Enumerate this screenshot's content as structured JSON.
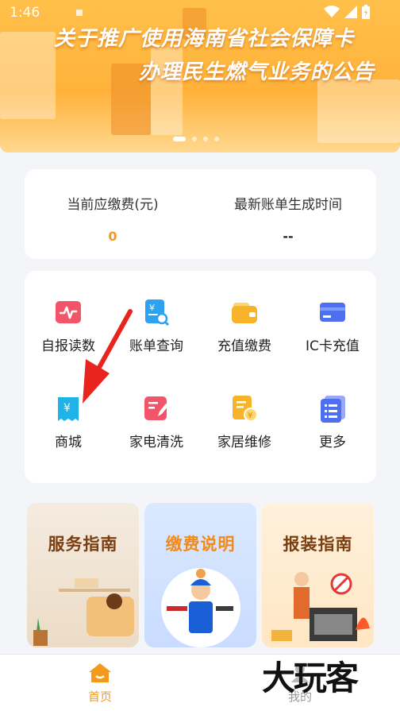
{
  "status_bar": {
    "time": "1:46"
  },
  "banner": {
    "title": "关于推广使用海南省社会保障卡",
    "subtitle": "办理民生燃气业务的公告",
    "page_count": 4,
    "active_page": 1
  },
  "fee": {
    "current_label": "当前应缴费(元)",
    "current_value": "0",
    "bill_label": "最新账单生成时间",
    "bill_value": "--",
    "accent": "#f39a1d"
  },
  "menu": {
    "items": [
      {
        "label": "自报读数",
        "icon": "chart-pulse-icon"
      },
      {
        "label": "账单查询",
        "icon": "bill-search-icon"
      },
      {
        "label": "充值缴费",
        "icon": "wallet-icon"
      },
      {
        "label": "IC卡充值",
        "icon": "card-icon"
      },
      {
        "label": "商城",
        "icon": "receipt-yen-icon"
      },
      {
        "label": "家电清洗",
        "icon": "edit-note-icon"
      },
      {
        "label": "家居维修",
        "icon": "document-coin-icon"
      },
      {
        "label": "更多",
        "icon": "more-list-icon"
      }
    ]
  },
  "guides": [
    {
      "title": "服务指南",
      "color": "#7a3e10"
    },
    {
      "title": "缴费说明",
      "color": "#f08a1c"
    },
    {
      "title": "报装指南",
      "color": "#7a3e10"
    }
  ],
  "tabs": [
    {
      "label": "首页",
      "active": true
    },
    {
      "label": "我的",
      "active": false
    }
  ],
  "watermark": "大玩客"
}
